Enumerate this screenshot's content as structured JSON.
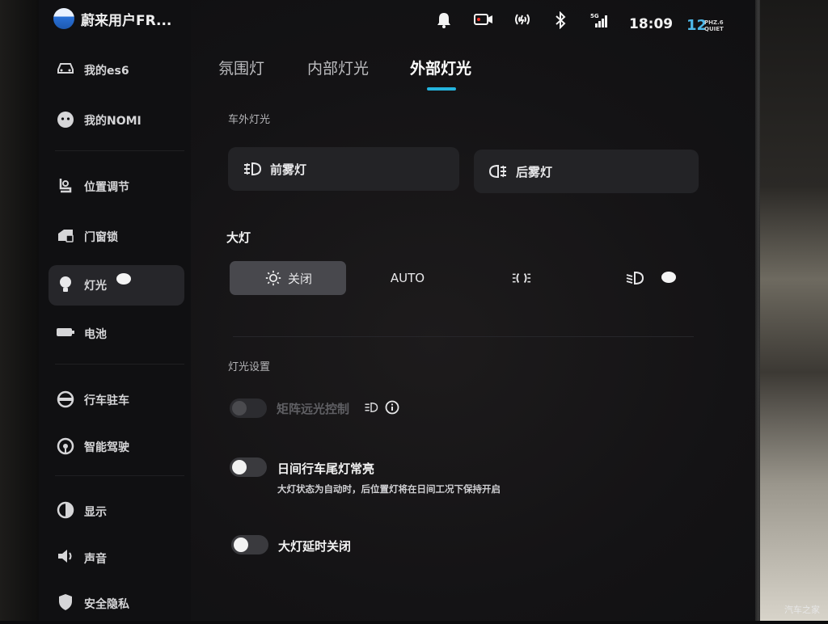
{
  "header": {
    "user_name": "蔚来用户FR...",
    "time": "18:09",
    "temperature": "12",
    "noise_line1": "PHZ.6",
    "noise_line2": "QUIET"
  },
  "status_icons": [
    "bell-icon",
    "dashcam-icon",
    "hotspot-icon",
    "bluetooth-icon",
    "signal-5g-icon"
  ],
  "sidebar": {
    "items": [
      {
        "label": "我的es6",
        "icon": "car-icon"
      },
      {
        "label": "我的NOMI",
        "icon": "nomi-icon"
      },
      {
        "label": "位置调节",
        "icon": "seat-icon"
      },
      {
        "label": "门窗锁",
        "icon": "door-lock-icon"
      },
      {
        "label": "灯光",
        "icon": "bulb-icon",
        "active": true
      },
      {
        "label": "电池",
        "icon": "battery-icon"
      },
      {
        "label": "行车驻车",
        "icon": "steering-icon"
      },
      {
        "label": "智能驾驶",
        "icon": "assist-drive-icon"
      },
      {
        "label": "显示",
        "icon": "display-icon"
      },
      {
        "label": "声音",
        "icon": "speaker-icon"
      },
      {
        "label": "安全隐私",
        "icon": "shield-icon"
      }
    ]
  },
  "tabs": [
    {
      "label": "氛围灯"
    },
    {
      "label": "内部灯光"
    },
    {
      "label": "外部灯光",
      "active": true
    }
  ],
  "exterior": {
    "section_title": "车外灯光",
    "front_fog_label": "前雾灯",
    "rear_fog_label": "后雾灯"
  },
  "headlight": {
    "title": "大灯",
    "options": [
      {
        "label": "关闭",
        "icon": "sun-icon",
        "selected": true
      },
      {
        "label": "AUTO"
      },
      {
        "label": "",
        "icon": "position-light-icon"
      },
      {
        "label": "",
        "icon": "low-beam-icon"
      }
    ]
  },
  "settings": {
    "section_title": "灯光设置",
    "matrix_label": "矩阵远光控制",
    "drl_label": "日间行车尾灯常亮",
    "drl_sub": "大灯状态为自动时，后位置灯将在日间工况下保持开启",
    "delay_label": "大灯延时关闭"
  },
  "watermark": "汽车之家"
}
